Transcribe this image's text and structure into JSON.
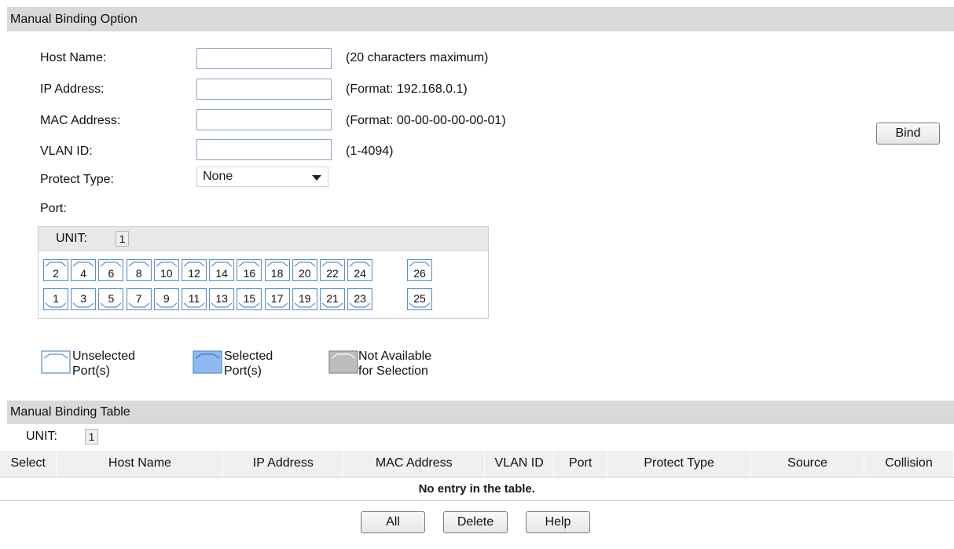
{
  "option_section": {
    "title": "Manual Binding Option"
  },
  "form": {
    "host_name": {
      "label": "Host Name:",
      "value": "",
      "hint": "(20 characters maximum)"
    },
    "ip_address": {
      "label": "IP Address:",
      "value": "",
      "hint": "(Format: 192.168.0.1)"
    },
    "mac_address": {
      "label": "MAC Address:",
      "value": "",
      "hint": "(Format: 00-00-00-00-00-01)"
    },
    "vlan_id": {
      "label": "VLAN ID:",
      "value": "",
      "hint": "(1-4094)"
    },
    "protect_type": {
      "label": "Protect Type:",
      "selected": "None"
    },
    "port_label": "Port:"
  },
  "bind_button": "Bind",
  "port_panel": {
    "unit_label": "UNIT:",
    "unit_value": "1",
    "top_ports": [
      "2",
      "4",
      "6",
      "8",
      "10",
      "12",
      "14",
      "16",
      "18",
      "20",
      "22",
      "24",
      "26"
    ],
    "bottom_ports": [
      "1",
      "3",
      "5",
      "7",
      "9",
      "11",
      "13",
      "15",
      "17",
      "19",
      "21",
      "23",
      "25"
    ]
  },
  "legend": {
    "unselected": {
      "line1": "Unselected",
      "line2": "Port(s)",
      "color": "#ffffff"
    },
    "selected": {
      "line1": "Selected",
      "line2": "Port(s)",
      "color": "#8fb9f2"
    },
    "not_available": {
      "line1": "Not Available",
      "line2": "for Selection",
      "color": "#bdbdbd"
    }
  },
  "table_section": {
    "title": "Manual Binding Table",
    "unit_label": "UNIT:",
    "unit_value": "1",
    "columns": [
      "Select",
      "Host Name",
      "IP Address",
      "MAC Address",
      "VLAN ID",
      "Port",
      "Protect Type",
      "Source",
      "Collision"
    ],
    "empty_message": "No entry in the table."
  },
  "buttons": {
    "all": "All",
    "delete": "Delete",
    "help": "Help"
  },
  "colors": {
    "port_outline": "#5b93c9",
    "header_bg": "#d9d9d9"
  }
}
